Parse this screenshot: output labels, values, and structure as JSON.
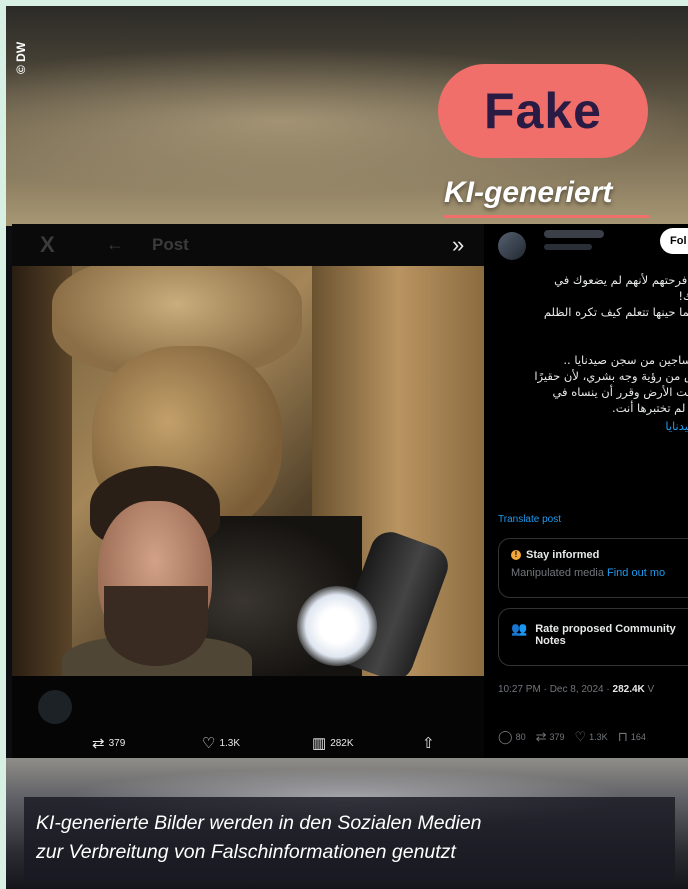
{
  "credit": "© DW",
  "badge": {
    "text": "Fake",
    "color": "#f06f6a"
  },
  "subtitle": "KI-generiert",
  "post": {
    "header": {
      "logo": "X",
      "back": "←",
      "title": "Post",
      "expand": "»"
    },
    "follow_label": "Fol",
    "text_lines": [
      "م فرحتهم لأنهم لم يضعوك في",
      "وك!",
      "ربما حينها تتعلم كيف تكره الظلم",
      "مساجين من سجن صيدنايا ..",
      "ش من رؤية وجه بشري، لأن حقيرًا",
      "تحت الأرض وقرر أن ينساه في",
      "ي لم تختبرها أنت."
    ],
    "hashtag": "صيدنايا",
    "translate": "Translate post",
    "notice": {
      "title": "Stay informed",
      "body": "Manipulated media",
      "link": "Find out mo"
    },
    "community": {
      "line1": "Rate proposed Community",
      "line2": "Notes"
    },
    "meta": {
      "time": "10:27 PM · Dec 8, 2024 · ",
      "views": "282.4K",
      "suffix": " V"
    },
    "side_actions": {
      "replies": "80",
      "reposts": "379",
      "likes": "1.3K",
      "bookmarks": "164"
    },
    "actions": {
      "reposts": "379",
      "likes": "1.3K",
      "views": "282K"
    }
  },
  "caption": {
    "line1": "KI-generierte Bilder werden in den Sozialen Medien",
    "line2": "zur Verbreitung von Falschinformationen genutzt"
  },
  "icons": [
    "x-logo-icon",
    "back-arrow-icon",
    "expand-icon",
    "repost-icon",
    "heart-icon",
    "views-icon",
    "share-icon",
    "reply-icon",
    "bookmark-icon",
    "warning-icon",
    "community-notes-icon"
  ]
}
